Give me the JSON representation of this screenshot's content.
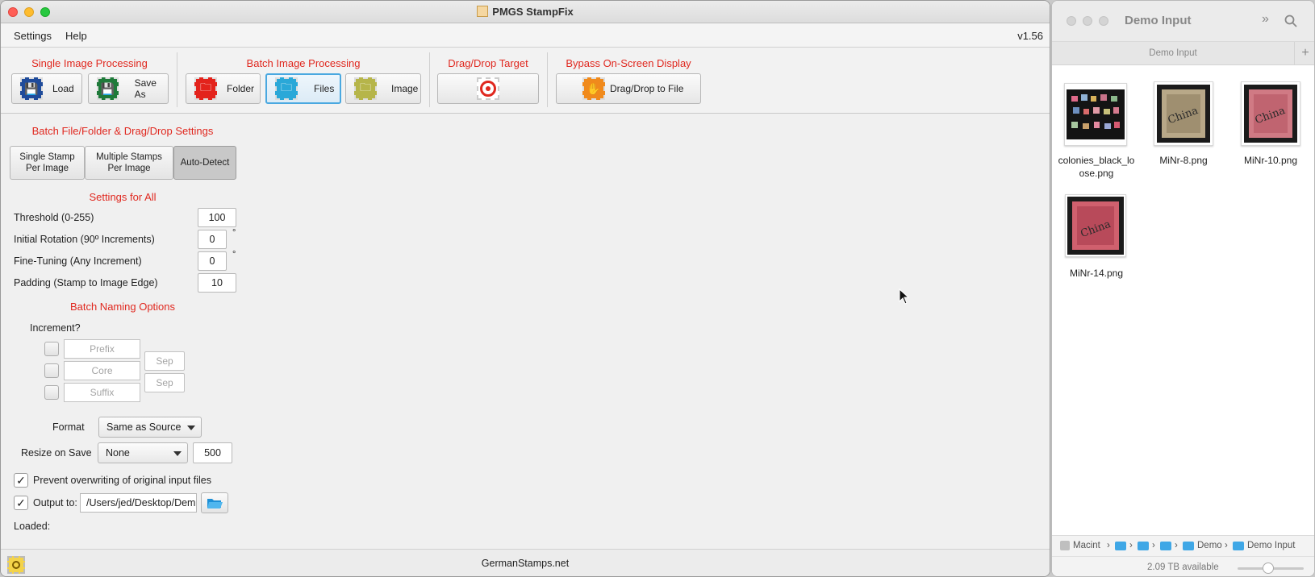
{
  "app": {
    "title": "PMGS StampFix",
    "version": "v1.56",
    "menu": [
      "Settings",
      "Help"
    ]
  },
  "toolbar": {
    "groups": {
      "single": "Single Image Processing",
      "batch": "Batch Image Processing",
      "dragdrop": "Drag/Drop Target",
      "bypass": "Bypass On-Screen Display"
    },
    "buttons": {
      "load": "Load",
      "save_as": "Save As",
      "folder": "Folder",
      "files": "Files",
      "image": "Image",
      "drag_drop_to_file": "Drag/Drop to File"
    }
  },
  "settings": {
    "batch_title": "Batch File/Folder & Drag/Drop Settings",
    "modes": {
      "single": "Single Stamp Per Image",
      "multiple": "Multiple Stamps Per Image",
      "auto": "Auto-Detect"
    },
    "all_title": "Settings for All",
    "fields": {
      "threshold_label": "Threshold (0-255)",
      "threshold_value": "100",
      "rotation_label": "Initial Rotation (90º Increments)",
      "rotation_value": "0",
      "fine_label": "Fine-Tuning (Any Increment)",
      "fine_value": "0",
      "padding_label": "Padding (Stamp to Image Edge)",
      "padding_value": "10",
      "degree": "°"
    },
    "naming": {
      "title": "Batch Naming Options",
      "increment": "Increment?",
      "prefix": "Prefix",
      "core": "Core",
      "suffix": "Suffix",
      "sep": "Sep"
    },
    "format_label": "Format",
    "format_value": "Same as Source",
    "resize_label": "Resize on Save",
    "resize_value": "None",
    "resize_size": "500",
    "prevent_label": "Prevent overwriting of original input files",
    "output_label": "Output to:",
    "output_path": "/Users/jed/Desktop/Dem",
    "loaded_label": "Loaded:",
    "check_mark": "✓"
  },
  "status": {
    "site": "GermanStamps.net"
  },
  "finder": {
    "title": "Demo Input",
    "tab": "Demo Input",
    "plus": "+",
    "files": [
      {
        "name": "colonies_black_lo ose.png"
      },
      {
        "name": "MiNr-8.png"
      },
      {
        "name": "MiNr-10.png"
      },
      {
        "name": "MiNr-14.png"
      }
    ],
    "path": [
      "Macint",
      "Demo",
      "Demo Input"
    ],
    "available": "2.09 TB available",
    "zoom_fraction": 0.45
  },
  "colors": {
    "accent_red": "#e0281f",
    "selection_blue": "#4aa8e0"
  }
}
